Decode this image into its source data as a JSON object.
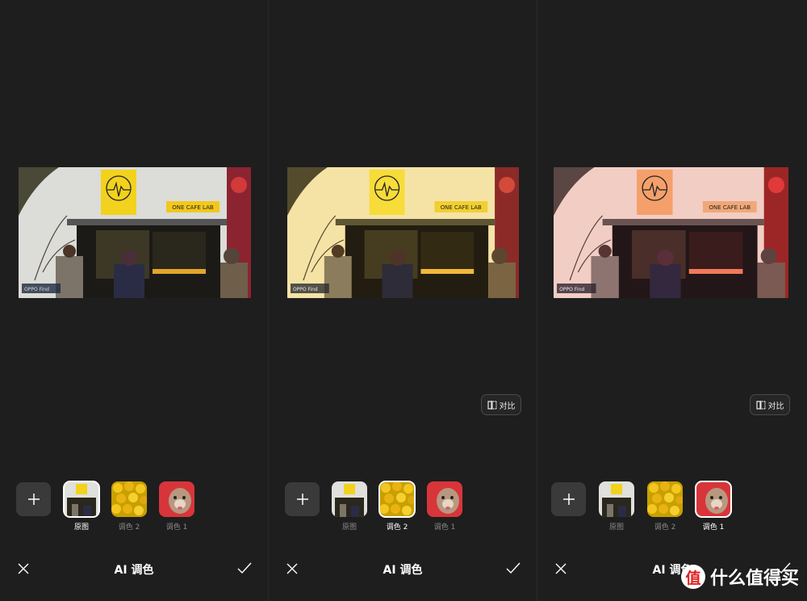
{
  "panels": [
    {
      "id": "original",
      "filter": "none",
      "show_compare": false,
      "compare_label": "对比",
      "photo": {
        "sign_text": "ONE CAFE LAB",
        "camera_tag": "OPPO Find"
      },
      "thumbs": [
        {
          "label": "原图",
          "active": true
        },
        {
          "label": "调色 2",
          "active": false
        },
        {
          "label": "调色 1",
          "active": false
        }
      ],
      "bottom": {
        "title": "AI 调色"
      }
    },
    {
      "id": "tone2",
      "filter": "yellow",
      "show_compare": true,
      "compare_label": "对比",
      "photo": {
        "sign_text": "ONE CAFE LAB",
        "camera_tag": "OPPO Find"
      },
      "thumbs": [
        {
          "label": "原图",
          "active": false
        },
        {
          "label": "调色 2",
          "active": true
        },
        {
          "label": "调色 1",
          "active": false
        }
      ],
      "bottom": {
        "title": "AI 调色"
      }
    },
    {
      "id": "tone1",
      "filter": "pink",
      "show_compare": true,
      "compare_label": "对比",
      "photo": {
        "sign_text": "ONE CAFE LAB",
        "camera_tag": "OPPO Find"
      },
      "thumbs": [
        {
          "label": "原图",
          "active": false
        },
        {
          "label": "调色 2",
          "active": false
        },
        {
          "label": "调色 1",
          "active": true
        }
      ],
      "bottom": {
        "title": "AI 调色"
      }
    }
  ],
  "watermark": {
    "badge": "值",
    "text": "什么值得买"
  },
  "colors": {
    "background": "#1e1e1e",
    "accent": "#ffffff",
    "muted": "#8a8a8a",
    "cafe_yellow": "#f2d21c"
  }
}
